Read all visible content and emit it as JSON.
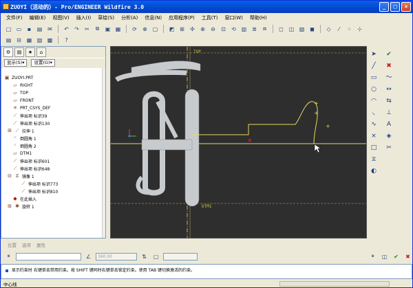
{
  "window": {
    "title": "ZUOYI（活动的）- Pro/ENGINEER Wildfire 3.0",
    "buttons": [
      "_",
      "□",
      "×"
    ]
  },
  "menubar": {
    "items": [
      "文件(F)",
      "编辑(E)",
      "视图(V)",
      "插入(I)",
      "草绘(S)",
      "分析(A)",
      "信息(N)",
      "应用程序(P)",
      "工具(T)",
      "窗口(W)",
      "帮助(H)"
    ]
  },
  "panel": {
    "show_label": "显示(S)▾",
    "settings_label": "设置(G)▾"
  },
  "tree": {
    "items": [
      {
        "label": "ZUOYI.PRT",
        "icon": "part-icon",
        "indent": 0
      },
      {
        "label": "RIGHT",
        "icon": "datum-plane-icon",
        "indent": 1
      },
      {
        "label": "TOP",
        "icon": "datum-plane-icon",
        "indent": 1
      },
      {
        "label": "FRONT",
        "icon": "datum-plane-icon",
        "indent": 1
      },
      {
        "label": "PRT_CSYS_DEF",
        "icon": "csys-icon",
        "indent": 1
      },
      {
        "label": "伸出项 标识39",
        "icon": "extrude-icon",
        "indent": 1
      },
      {
        "label": "伸出项 标识130",
        "icon": "extrude-icon",
        "indent": 1
      },
      {
        "label": "拉伸 1",
        "icon": "extrude-icon",
        "indent": 1
      },
      {
        "label": "倒圆角 1",
        "icon": "round-icon",
        "indent": 1
      },
      {
        "label": "倒圆角 2",
        "icon": "round-icon",
        "indent": 1
      },
      {
        "label": "DTM1",
        "icon": "datum-plane-icon",
        "indent": 1
      },
      {
        "label": "伸出项 标识601",
        "icon": "extrude-icon",
        "indent": 1
      },
      {
        "label": "伸出项 标识648",
        "icon": "extrude-icon",
        "indent": 1
      },
      {
        "label": "镜像 1",
        "icon": "mirror-icon",
        "indent": 1
      },
      {
        "label": "伸出项 标识773",
        "icon": "extrude-icon",
        "indent": 2
      },
      {
        "label": "伸出项 标识810",
        "icon": "extrude-icon",
        "indent": 2
      },
      {
        "label": "在此插入",
        "icon": "insert-here-icon",
        "indent": 1
      },
      {
        "label": "旋转 1",
        "icon": "revolve-icon",
        "indent": 1
      }
    ]
  },
  "canvas": {
    "label_top": "TOP",
    "label_dtm1": "DTM1"
  },
  "dashboard": {
    "tabs": [
      "位置",
      "选项",
      "属性"
    ]
  },
  "input": {
    "value_placeholder": "360.00"
  },
  "message": {
    "text": "显示约束时 右键单击禁用约束。按 SHIFT 键同时右键单击锁定约束。使用 TAB 键切换激活的约束。"
  },
  "status": {
    "left": "中心线"
  },
  "colors": {
    "canvas_bg": "#2E2E2E",
    "sketch": "#E8D85A",
    "part": "#C8CBCE",
    "titlebar": "#0A5FE8"
  }
}
